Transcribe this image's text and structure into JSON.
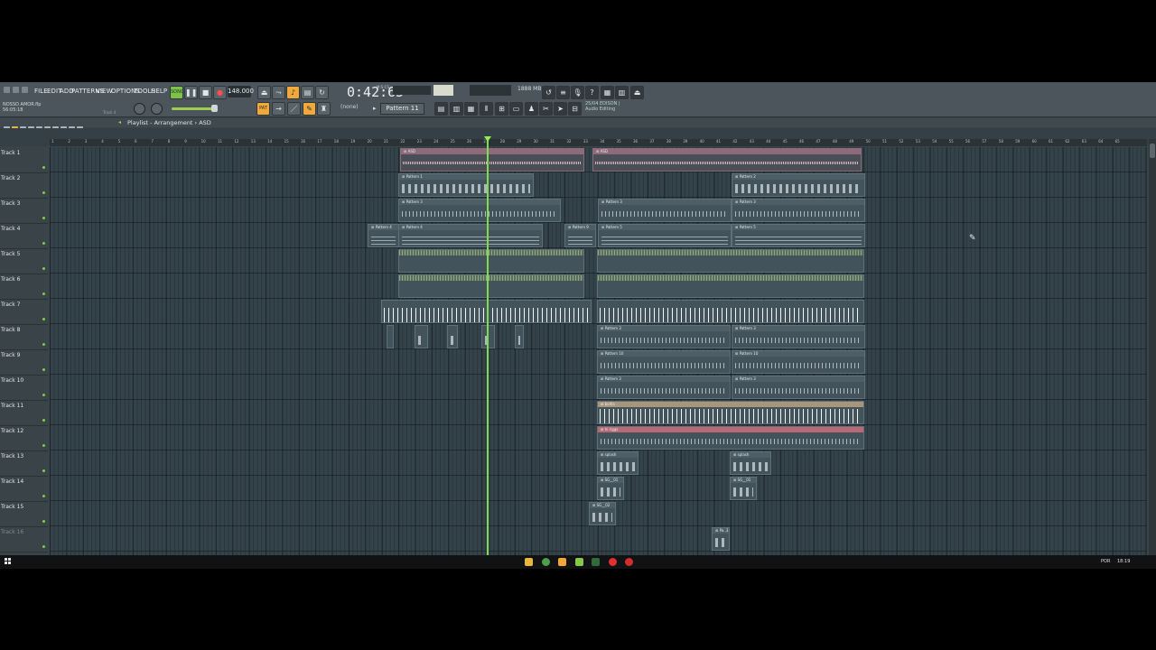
{
  "menu": [
    "FILE",
    "EDIT",
    "ADD",
    "PATTERNS",
    "VIEW",
    "OPTIONS",
    "TOOLS",
    "HELP"
  ],
  "transport": {
    "tempo": "148.000",
    "time": "0:42:65",
    "time_small": "M:S:CS",
    "mode": "SONG"
  },
  "memory": "1888 MB",
  "pattern_selector": "Pattern 11",
  "snap": "(none)",
  "edison_hint": {
    "line1": "25/04 EDISON |",
    "line2": "Audio Editing"
  },
  "project": {
    "file": "NOSSO AMOR.flp",
    "time": "56:05:18",
    "track_label": "Track 4"
  },
  "playlist": {
    "title": "Playlist - Arrangement › ASD"
  },
  "ruler": [
    "1",
    "2",
    "3",
    "4",
    "5",
    "6",
    "7",
    "8",
    "9",
    "10",
    "11",
    "12",
    "13",
    "14",
    "15",
    "16",
    "17",
    "18",
    "19",
    "20",
    "21",
    "22",
    "23",
    "24",
    "25",
    "26",
    "27",
    "28",
    "29",
    "30",
    "31",
    "32",
    "33",
    "34",
    "35",
    "36",
    "37",
    "38",
    "39",
    "40",
    "41",
    "42",
    "43",
    "44",
    "45",
    "46",
    "47",
    "48",
    "49",
    "50",
    "51",
    "52",
    "53",
    "54",
    "55",
    "56",
    "57",
    "58",
    "59",
    "60",
    "61",
    "62",
    "63",
    "64",
    "65"
  ],
  "tracks": [
    "Track 1",
    "Track 2",
    "Track 3",
    "Track 4",
    "Track 5",
    "Track 6",
    "Track 7",
    "Track 8",
    "Track 9",
    "Track 10",
    "Track 11",
    "Track 12",
    "Track 13",
    "Track 14",
    "Track 15",
    "Track 16"
  ],
  "clips": [
    {
      "label": "ASD",
      "kind": "audio"
    },
    {
      "label": "Pattern 1",
      "kind": "notes"
    },
    {
      "label": "Pattern 2",
      "kind": "notes"
    },
    {
      "label": "Pattern 3",
      "kind": "notes2"
    },
    {
      "label": "Pattern 4",
      "kind": "lines"
    },
    {
      "label": "Pattern 5",
      "kind": "lines"
    },
    {
      "label": "Pattern 9",
      "kind": "lines"
    },
    {
      "label": "Pattern 10",
      "kind": "notes2"
    },
    {
      "label": "bolha",
      "kind": "tan"
    },
    {
      "label": "hi riggs",
      "kind": "red"
    },
    {
      "label": "splash",
      "kind": "notes"
    },
    {
      "label": "SG__01",
      "kind": "notes"
    },
    {
      "label": "SG__02",
      "kind": "notes"
    },
    {
      "label": "Pa..3",
      "kind": "notes"
    }
  ],
  "taskbar": {
    "lang": "POR",
    "clock": "18:19"
  }
}
